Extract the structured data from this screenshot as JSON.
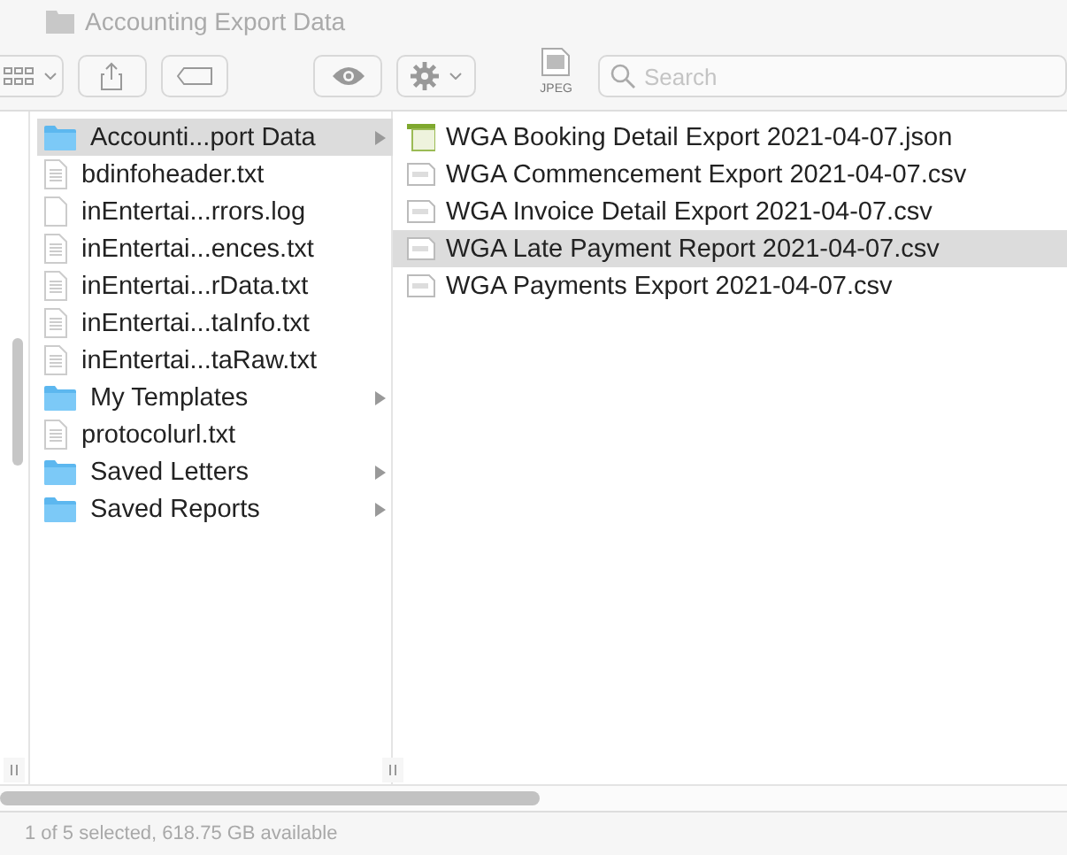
{
  "window": {
    "title": "Accounting Export Data"
  },
  "toolbar": {
    "search": {
      "placeholder": "Search"
    },
    "preview_label": "JPEG"
  },
  "columns": [
    {
      "items": [
        {
          "name": "Accounti...port Data",
          "kind": "folder",
          "selected": true
        },
        {
          "name": "bdinfoheader.txt",
          "kind": "text",
          "selected": false
        },
        {
          "name": "inEntertai...rrors.log",
          "kind": "blank",
          "selected": false
        },
        {
          "name": "inEntertai...ences.txt",
          "kind": "text",
          "selected": false
        },
        {
          "name": "inEntertai...rData.txt",
          "kind": "text",
          "selected": false
        },
        {
          "name": "inEntertai...taInfo.txt",
          "kind": "text",
          "selected": false
        },
        {
          "name": "inEntertai...taRaw.txt",
          "kind": "text",
          "selected": false
        },
        {
          "name": "My Templates",
          "kind": "folder",
          "selected": false
        },
        {
          "name": "protocolurl.txt",
          "kind": "text",
          "selected": false
        },
        {
          "name": "Saved Letters",
          "kind": "folder",
          "selected": false
        },
        {
          "name": "Saved Reports",
          "kind": "folder",
          "selected": false
        }
      ]
    },
    {
      "items": [
        {
          "name": "WGA Booking Detail Export 2021-04-07.json",
          "kind": "json",
          "selected": false
        },
        {
          "name": "WGA Commencement Export 2021-04-07.csv",
          "kind": "csv",
          "selected": false
        },
        {
          "name": "WGA Invoice Detail Export 2021-04-07.csv",
          "kind": "csv",
          "selected": false
        },
        {
          "name": "WGA Late Payment Report 2021-04-07.csv",
          "kind": "csv",
          "selected": true
        },
        {
          "name": "WGA Payments Export 2021-04-07.csv",
          "kind": "csv",
          "selected": false
        }
      ]
    }
  ],
  "status_bar": "1 of 5 selected, 618.75 GB available"
}
